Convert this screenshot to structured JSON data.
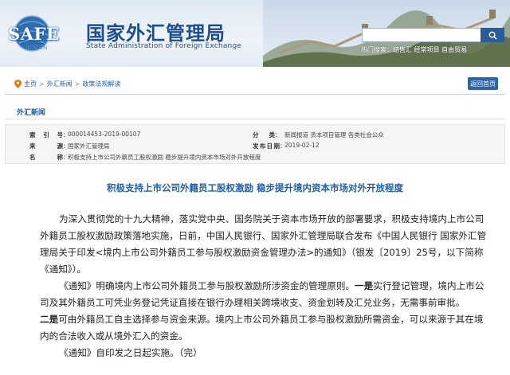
{
  "header": {
    "logo_text": "SAFE",
    "logo_domain": ".GOV.CN",
    "site_title": "国家外汇管理局",
    "site_subtitle": "State Administration of Foreign Exchange",
    "search_placeholder": "",
    "hot_words": "热门搜索：结售汇   经常项目   自由贸易",
    "colors": {
      "brand": "#1c4e8f",
      "search_button": "#2a5d96"
    }
  },
  "breadcrumb": {
    "items": [
      "主页",
      "外汇新闻",
      "政策法规解读"
    ],
    "separator": ">",
    "back_button": "返回首页"
  },
  "section_title": "外汇新闻",
  "meta": {
    "index_label": "索引号",
    "index_value": "000014453-2019-00107",
    "category_label": "分类",
    "category_value": "新闻报道  资本项目管理  各类社会公众",
    "source_label": "来源",
    "source_value": "国家外汇管理局",
    "date_label": "发布日期",
    "date_value": "2019-02-12",
    "name_label": "名称",
    "name_value": "积极支持上市公司外籍员工股权激励 稳步提升境内资本市场对外开放程度"
  },
  "article": {
    "title": "积极支持上市公司外籍员工股权激励 稳步提升境内资本市场对外开放程度",
    "p1": "为深入贯彻党的十九大精神，落实党中央、国务院关于资本市场开放的部署要求，积极支持境内上市公司外籍员工股权激励政策落地实施，日前，中国人民银行、国家外汇管理局联合发布《中国人民银行 国家外汇管理局关于印发<境内上市公司外籍员工参与股权激励资金管理办法>的通知》（银发〔2019〕25号，以下简称《通知》）。",
    "p2_a": "《通知》明确境内上市公司外籍员工参与股权激励所涉资金的管理原则。",
    "p2_b1": "一是",
    "p2_c": "实行登记管理，境内上市公司及其外籍员工可凭业务登记凭证直接在银行办理相关跨境收支、资金划转及汇兑业务，无需事前审批。",
    "p2_b2": "二是",
    "p2_d": "可由外籍员工自主选择参与资金来源。境内上市公司外籍员工参与股权激励所需资金，可以来源于其在境内的合法收入或从境外汇入的资金。",
    "p3": "《通知》自印发之日起实施。（完）"
  }
}
